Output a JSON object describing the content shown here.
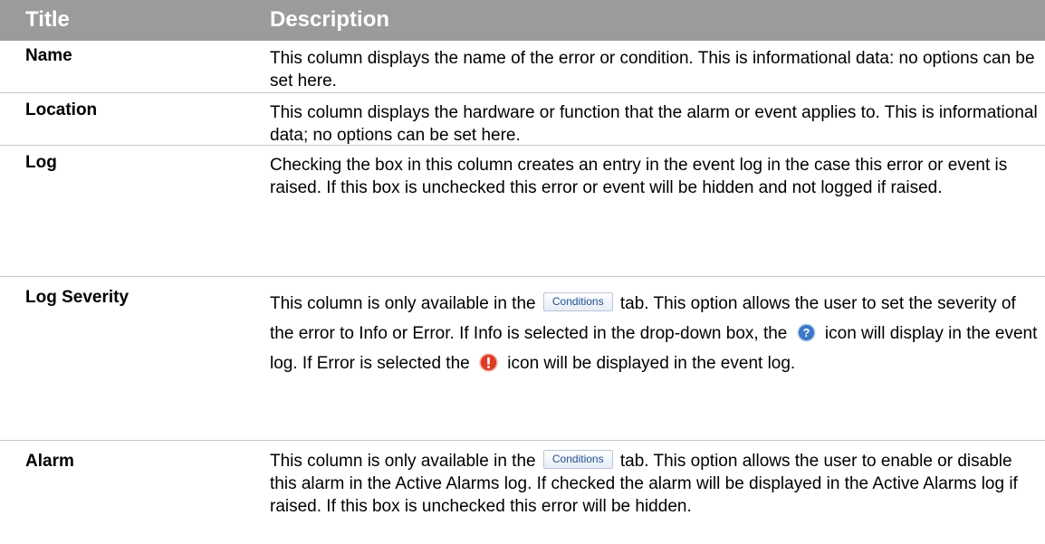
{
  "header": {
    "title": "Title",
    "description": "Description"
  },
  "rows": [
    {
      "title": "Name",
      "description": "This column displays the name of the error or condition. This is informational data: no options can be set here."
    },
    {
      "title": "Location",
      "description": "This column displays the hardware or function that the alarm or event applies to. This is informational data; no options can be set here."
    },
    {
      "title": "Log",
      "description": "Checking the box in this column creates an entry in the event log in the case this error or event is raised. If this box is unchecked this error or event will be hidden and not logged if raised."
    },
    {
      "title": "Log Severity",
      "d1": "This column is only available in the",
      "btn": "Conditions",
      "d2": "tab. This option allows the user to set the severity of the error to Info or Error. If Info is selected in the drop-down box, the",
      "info_icon": "info-question-icon",
      "d3": "icon will display in the event log. If Error is selected the",
      "error_icon": "error-exclamation-icon",
      "d4": "icon will be displayed in the event log."
    },
    {
      "title": "Alarm",
      "d1": "This column is only available in the",
      "btn": "Conditions",
      "d2": "tab. This option allows the user to enable or disable this alarm in the Active Alarms log. If checked the alarm will be displayed in the Active Alarms log if raised. If this box is unchecked this error will be hidden."
    }
  ],
  "colors": {
    "header_bg": "#9b9b9b",
    "header_text": "#ffffff",
    "divider": "#c8c8c8",
    "button_text": "#1f4f8f",
    "info_icon": "#3d78c8",
    "error_icon": "#dd3b26"
  }
}
